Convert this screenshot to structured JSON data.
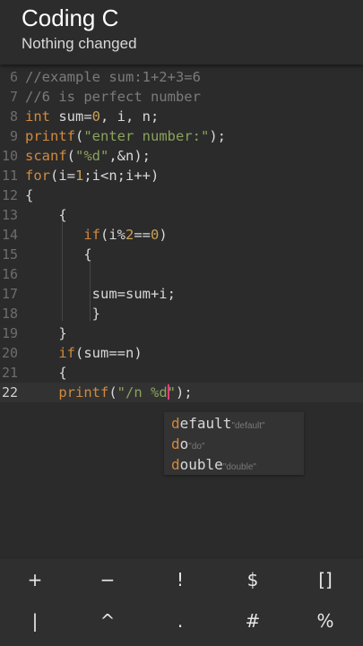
{
  "header": {
    "title": "Coding C",
    "subtitle": "Nothing changed"
  },
  "editor": {
    "lines": [
      {
        "num": "6",
        "tokens": [
          [
            "c",
            "//example sum:1+2+3=6"
          ]
        ]
      },
      {
        "num": "7",
        "tokens": [
          [
            "c",
            "//6 is perfect number"
          ]
        ]
      },
      {
        "num": "8",
        "tokens": [
          [
            "k",
            "int"
          ],
          [
            "p",
            " sum="
          ],
          [
            "n",
            "0"
          ],
          [
            "p",
            ", i, n;"
          ]
        ]
      },
      {
        "num": "9",
        "tokens": [
          [
            "k",
            "printf"
          ],
          [
            "p",
            "("
          ],
          [
            "s",
            "\"enter number:\""
          ],
          [
            "p",
            ");"
          ]
        ]
      },
      {
        "num": "10",
        "tokens": [
          [
            "k",
            "scanf"
          ],
          [
            "p",
            "("
          ],
          [
            "s",
            "\"%d\""
          ],
          [
            "p",
            ",&n);"
          ]
        ]
      },
      {
        "num": "11",
        "tokens": [
          [
            "k",
            "for"
          ],
          [
            "p",
            "(i="
          ],
          [
            "n",
            "1"
          ],
          [
            "p",
            ";i<n;i++)"
          ]
        ]
      },
      {
        "num": "12",
        "tokens": [
          [
            "p",
            "{"
          ]
        ]
      },
      {
        "num": "13",
        "tokens": [
          [
            "p",
            "    {"
          ]
        ]
      },
      {
        "num": "14",
        "tokens": [
          [
            "p",
            "       "
          ],
          [
            "k",
            "if"
          ],
          [
            "p",
            "(i%"
          ],
          [
            "n",
            "2"
          ],
          [
            "p",
            "=="
          ],
          [
            "n",
            "0"
          ],
          [
            "p",
            ")"
          ]
        ]
      },
      {
        "num": "15",
        "tokens": [
          [
            "p",
            "       {"
          ]
        ]
      },
      {
        "num": "16",
        "tokens": [
          [
            "p",
            ""
          ]
        ]
      },
      {
        "num": "17",
        "tokens": [
          [
            "p",
            "        sum=sum+i;"
          ]
        ]
      },
      {
        "num": "18",
        "tokens": [
          [
            "p",
            "        }"
          ]
        ]
      },
      {
        "num": "19",
        "tokens": [
          [
            "p",
            "    }"
          ]
        ]
      },
      {
        "num": "20",
        "tokens": [
          [
            "p",
            "    "
          ],
          [
            "k",
            "if"
          ],
          [
            "p",
            "(sum==n)"
          ]
        ]
      },
      {
        "num": "21",
        "tokens": [
          [
            "p",
            "    {"
          ]
        ]
      },
      {
        "num": "22",
        "tokens": [
          [
            "p",
            "    "
          ],
          [
            "k",
            "printf"
          ],
          [
            "p",
            "("
          ],
          [
            "s",
            "\"/n %d"
          ],
          [
            "cursor",
            ""
          ],
          [
            "s",
            "\""
          ],
          [
            "p",
            ");"
          ]
        ]
      }
    ]
  },
  "autocomplete": [
    {
      "match": "d",
      "rest": "efault",
      "hint": "\"default\""
    },
    {
      "match": "d",
      "rest": "o",
      "hint": "\"do\""
    },
    {
      "match": "d",
      "rest": "ouble",
      "hint": "\"double\""
    }
  ],
  "toolbar": {
    "row1": [
      "+",
      "−",
      "!",
      "$",
      "[]"
    ],
    "row2": [
      "|",
      "^",
      ".",
      "#",
      "%"
    ]
  },
  "colors": {
    "background": "#2b2b2b",
    "keyword": "#d18a3d",
    "string": "#8aa35c",
    "comment": "#7b7b7b",
    "cursor": "#e0407a"
  }
}
